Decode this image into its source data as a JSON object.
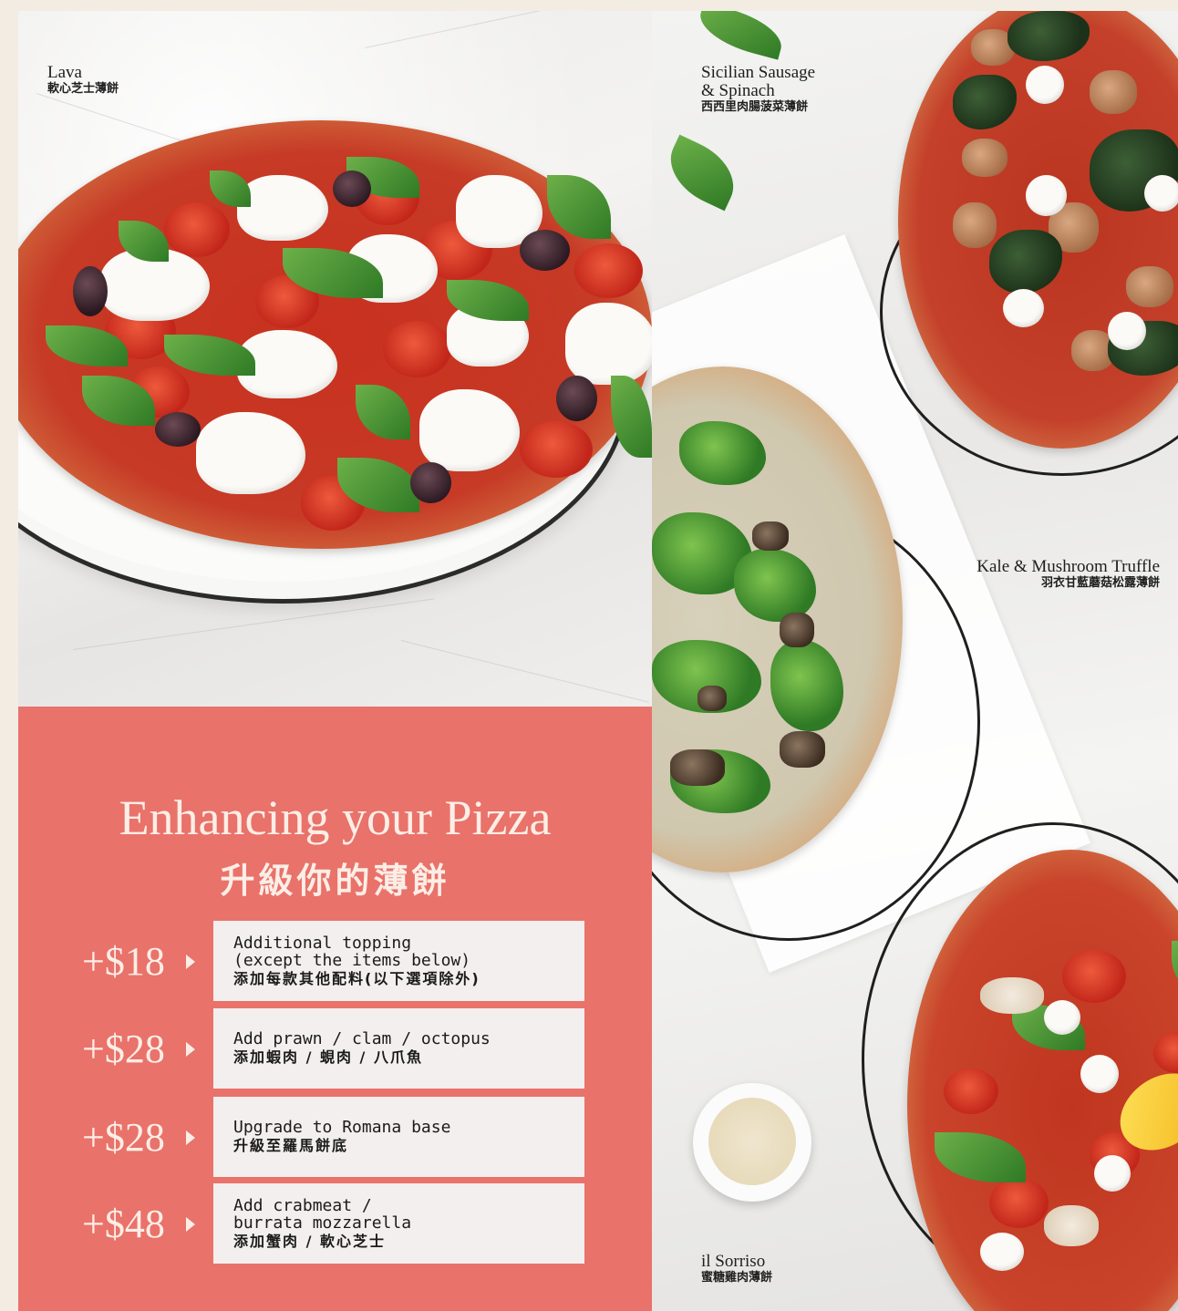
{
  "pizzas": {
    "lava": {
      "name_en": "Lava",
      "name_zh": "軟心芝士薄餅"
    },
    "sicilian": {
      "name_en": "Sicilian Sausage\n& Spinach",
      "name_zh": "西西里肉腸菠菜薄餅"
    },
    "kale": {
      "name_en": "Kale & Mushroom Truffle",
      "name_zh": "羽衣甘藍蘑菇松露薄餅"
    },
    "sorriso": {
      "name_en": "il Sorriso",
      "name_zh": "蜜糖雞肉薄餅"
    }
  },
  "enhance": {
    "title_en": "Enhancing your Pizza",
    "title_zh": "升級你的薄餅",
    "options": [
      {
        "price": "+$18",
        "en": "Additional topping\n(except the items below)",
        "zh": "添加每款其他配料(以下選項除外)"
      },
      {
        "price": "+$28",
        "en": "Add prawn / clam / octopus",
        "zh": "添加蝦肉 / 蜆肉 / 八爪魚"
      },
      {
        "price": "+$28",
        "en": "Upgrade to Romana base",
        "zh": "升級至羅馬餅底"
      },
      {
        "price": "+$48",
        "en": "Add crabmeat /\nburrata mozzarella",
        "zh": "添加蟹肉 / 軟心芝士"
      }
    ]
  },
  "colors": {
    "coral": "#e9726a",
    "cream_text": "#fbeee6",
    "box": "#f2efee",
    "page_bg": "#f3ece3"
  }
}
